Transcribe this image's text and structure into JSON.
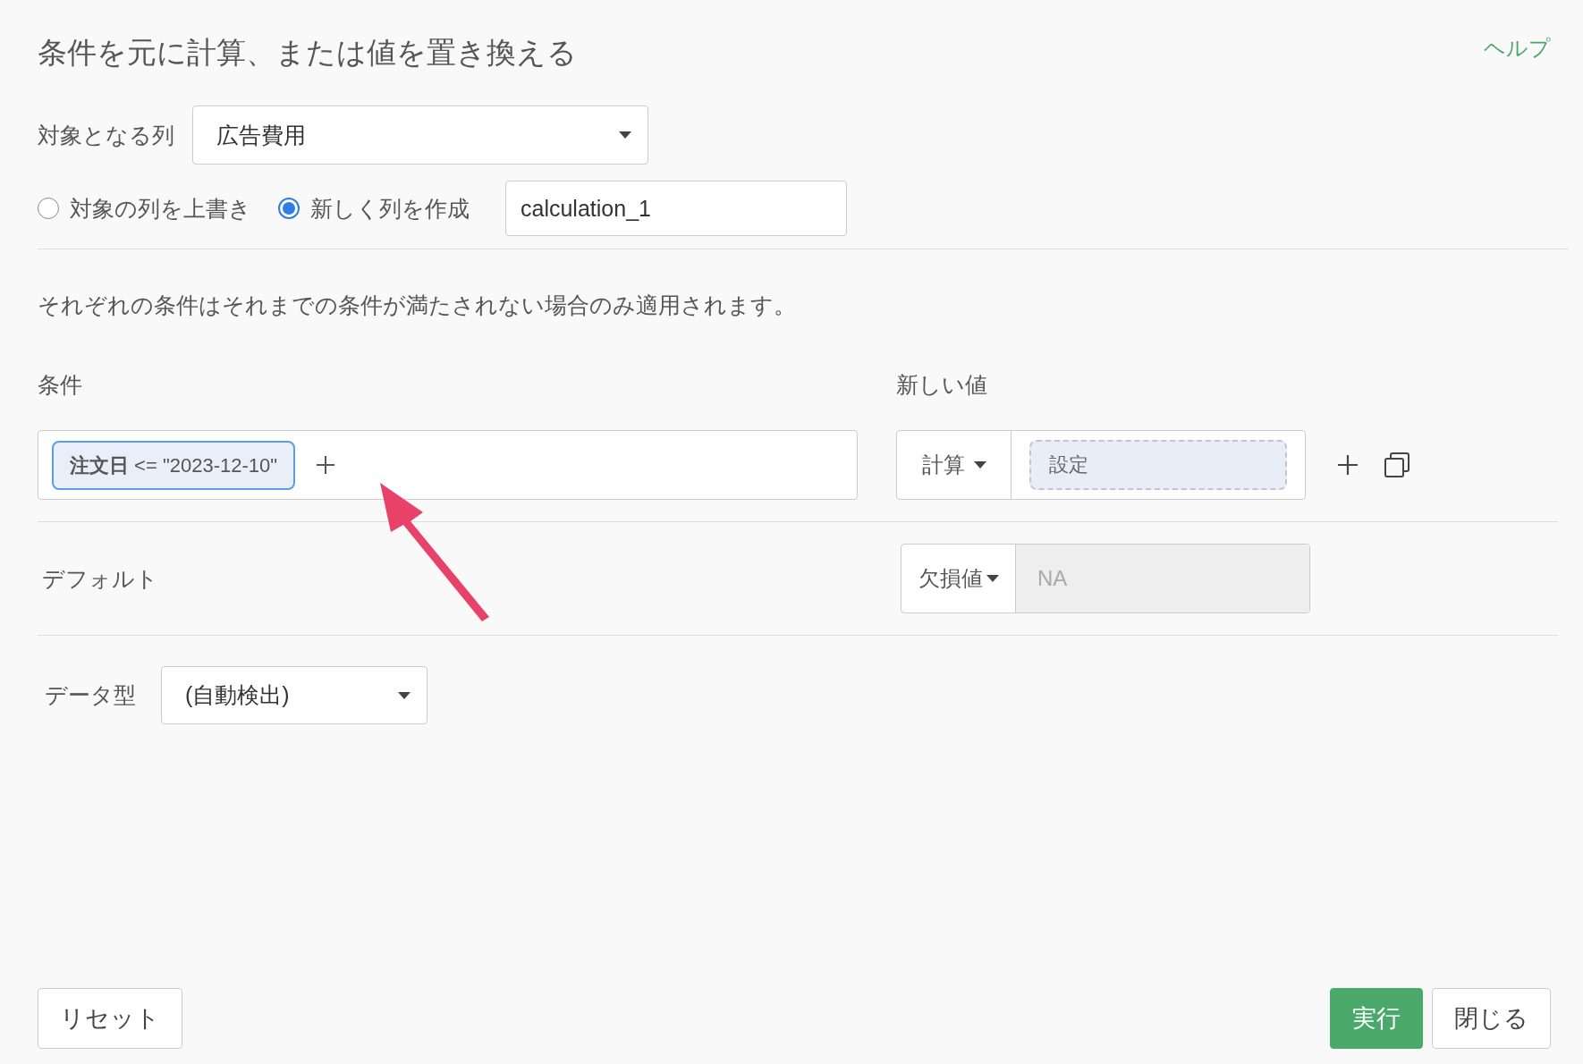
{
  "dialog": {
    "title": "条件を元に計算、または値を置き換える",
    "help_link": "ヘルプ"
  },
  "target_column": {
    "label": "対象となる列",
    "value": "広告費用"
  },
  "output_mode": {
    "options": [
      {
        "label": "対象の列を上書き",
        "selected": false
      },
      {
        "label": "新しく列を作成",
        "selected": true
      }
    ],
    "new_column_name": "calculation_1"
  },
  "description": "それぞれの条件はそれまでの条件が満たされない場合のみ適用されます。",
  "conditions": {
    "header": "条件",
    "value_header": "新しい値",
    "rows": [
      {
        "chip": "**注文日** <= \"2023-12-10\"",
        "value_type": "計算",
        "value_placeholder": "設定"
      }
    ]
  },
  "default": {
    "label": "デフォルト",
    "value_type": "欠損値",
    "placeholder": "NA",
    "disabled": true
  },
  "data_type": {
    "label": "データ型",
    "value": "(自動検出)"
  },
  "buttons": [
    {
      "label": "リセット",
      "kind": "secondary"
    },
    {
      "label": "実行",
      "kind": "primary"
    },
    {
      "label": "閉じる",
      "kind": "secondary"
    }
  ]
}
